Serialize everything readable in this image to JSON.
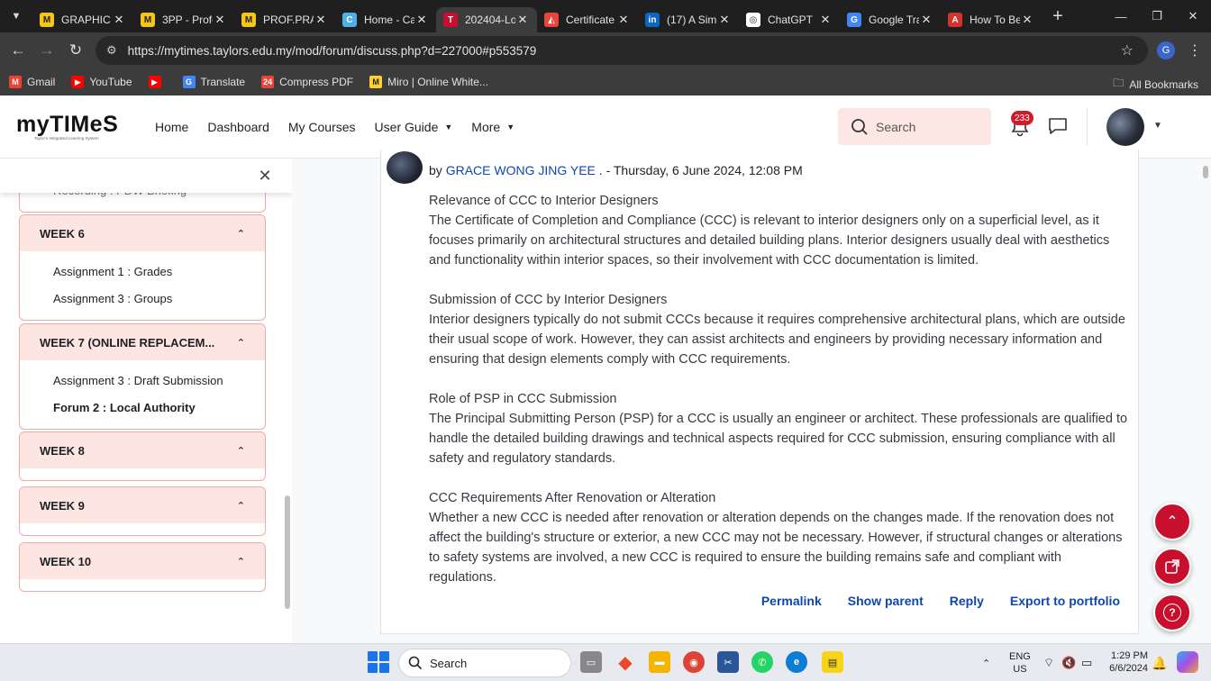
{
  "browser": {
    "tabs": [
      {
        "title": "GRAPHIC",
        "fav_color": "#f5c518",
        "fav_text": "M",
        "active": false
      },
      {
        "title": "3PP - Profe",
        "fav_color": "#f5c518",
        "fav_text": "M",
        "active": false
      },
      {
        "title": "PROF.PRA",
        "fav_color": "#f5c518",
        "fav_text": "M",
        "active": false
      },
      {
        "title": "Home - Ca",
        "fav_color": "#4fb0e8",
        "fav_text": "C",
        "active": false
      },
      {
        "title": "202404-Lo",
        "fav_color": "#c8102e",
        "fav_text": "T",
        "active": true
      },
      {
        "title": "Certificate",
        "fav_color": "#e8453c",
        "fav_text": "◭",
        "active": false
      },
      {
        "title": "(17) A Sim",
        "fav_color": "#0a66c2",
        "fav_text": "in",
        "active": false
      },
      {
        "title": "ChatGPT",
        "fav_color": "#ffffff",
        "fav_text": "◎",
        "active": false
      },
      {
        "title": "Google Tra",
        "fav_color": "#4285f4",
        "fav_text": "G",
        "active": false
      },
      {
        "title": "How To Be",
        "fav_color": "#d0342c",
        "fav_text": "A",
        "active": false
      }
    ],
    "url": "https://mytimes.taylors.edu.my/mod/forum/discuss.php?d=227000#p553579",
    "profile_initial": "G",
    "bookmarks": [
      {
        "label": "Gmail",
        "color": "#ea4335",
        "glyph": "M"
      },
      {
        "label": "YouTube",
        "color": "#ff0000",
        "glyph": "▶"
      },
      {
        "label": "",
        "color": "#ff0000",
        "glyph": "▶"
      },
      {
        "label": "Translate",
        "color": "#4285f4",
        "glyph": "G"
      },
      {
        "label": "Compress PDF",
        "color": "#e8453c",
        "glyph": "24"
      },
      {
        "label": "Miro | Online White...",
        "color": "#ffd02f",
        "glyph": "M"
      }
    ],
    "all_bookmarks": "All Bookmarks"
  },
  "site": {
    "logo_text": "myTIMeS",
    "logo_tagline": "Taylor's Integrated Learning System",
    "nav": [
      {
        "label": "Home",
        "dropdown": false
      },
      {
        "label": "Dashboard",
        "dropdown": false
      },
      {
        "label": "My Courses",
        "dropdown": false
      },
      {
        "label": "User Guide",
        "dropdown": true
      },
      {
        "label": "More",
        "dropdown": true
      }
    ],
    "search_placeholder": "Search",
    "notification_count": "233",
    "accent": "#c8102e"
  },
  "drawer": {
    "cutoff_item": "Recording : PDW Briefing",
    "weeks": [
      {
        "title": "WEEK 6",
        "items": [
          "Assignment 1 : Grades",
          "Assignment 3 : Groups"
        ],
        "current": -1
      },
      {
        "title": "WEEK 7 (ONLINE REPLACEM...",
        "items": [
          "Assignment 3 : Draft Submission",
          "Forum 2 : Local Authority"
        ],
        "current": 1
      },
      {
        "title": "WEEK 8",
        "items": [],
        "current": -1
      },
      {
        "title": "WEEK 9",
        "items": [],
        "current": -1
      },
      {
        "title": "WEEK 10",
        "items": [],
        "current": -1
      }
    ]
  },
  "post": {
    "by": "by",
    "author": "GRACE WONG JING YEE",
    "date": ". - Thursday, 6 June 2024, 12:08 PM",
    "sections": [
      {
        "heading": "Relevance of CCC to Interior Designers",
        "text": "The Certificate of Completion and Compliance (CCC) is relevant to interior designers only on a superficial level, as it focuses primarily on architectural structures and detailed building plans. Interior designers usually deal with aesthetics and functionality within interior spaces, so their involvement with CCC documentation is limited."
      },
      {
        "heading": "Submission of CCC by Interior Designers",
        "text": "Interior designers typically do not submit CCCs because it requires comprehensive architectural plans, which are outside their usual scope of work. However, they can assist architects and engineers by providing necessary information and ensuring that design elements comply with CCC requirements."
      },
      {
        "heading": "Role of PSP in CCC Submission",
        "text": "The Principal Submitting Person (PSP) for a CCC is usually an engineer or architect. These professionals are qualified to handle the detailed building drawings and technical aspects required for CCC submission, ensuring compliance with all safety and regulatory standards."
      },
      {
        "heading": "CCC Requirements After Renovation or Alteration",
        "text": "Whether a new CCC is needed after renovation or alteration depends on the changes made. If the renovation does not affect the building's structure or exterior, a new CCC may not be necessary. However, if structural changes or alterations to safety systems are involved, a new CCC is required to ensure the building remains safe and compliant with regulations."
      }
    ],
    "actions": [
      "Permalink",
      "Show parent",
      "Reply",
      "Export to portfolio"
    ]
  },
  "taskbar": {
    "search_label": "Search",
    "language": "ENG",
    "region": "US",
    "time": "1:29 PM",
    "date": "6/6/2024"
  }
}
